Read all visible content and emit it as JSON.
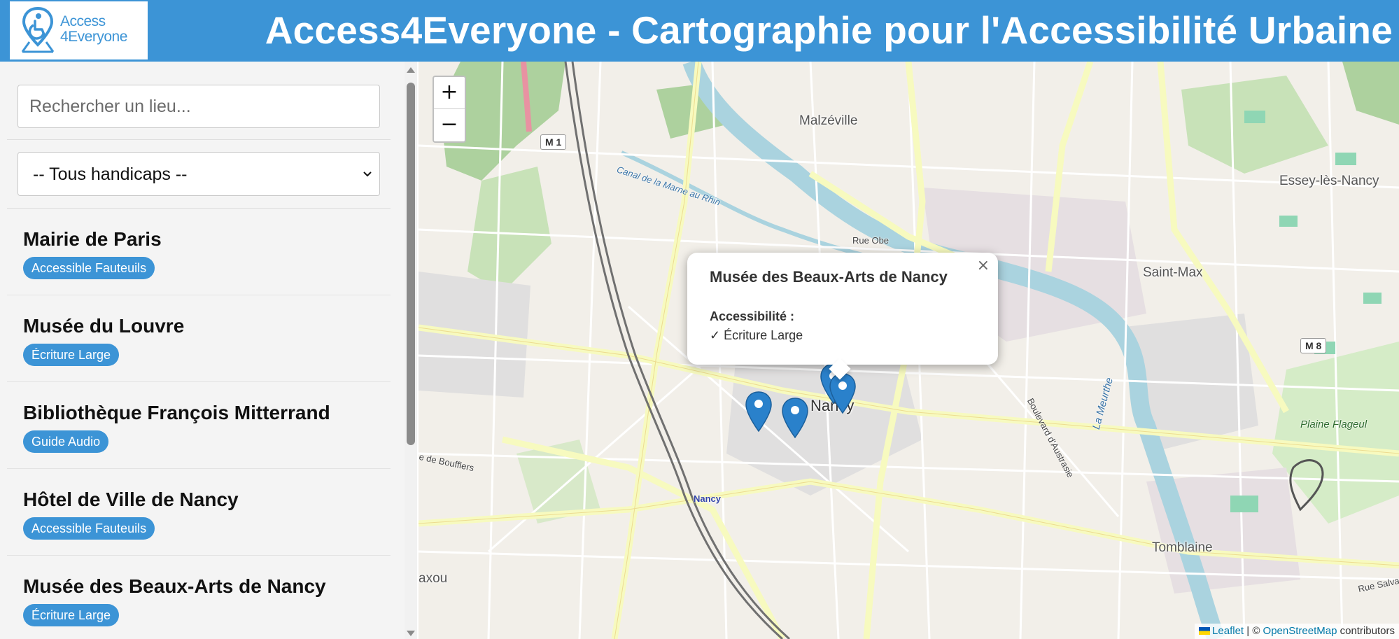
{
  "header": {
    "logo_line1": "Access",
    "logo_line2": "4Everyone",
    "title": "Access4Everyone - Cartographie pour l'Accessibilité Urbaine"
  },
  "sidebar": {
    "search": {
      "placeholder": "Rechercher un lieu...",
      "value": ""
    },
    "filter": {
      "selected": "-- Tous handicaps --"
    },
    "places": [
      {
        "name": "Mairie de Paris",
        "badge": "Accessible Fauteuils"
      },
      {
        "name": "Musée du Louvre",
        "badge": "Écriture Large"
      },
      {
        "name": "Bibliothèque François Mitterrand",
        "badge": "Guide Audio"
      },
      {
        "name": "Hôtel de Ville de Nancy",
        "badge": "Accessible Fauteuils"
      },
      {
        "name": "Musée des Beaux-Arts de Nancy",
        "badge": "Écriture Large"
      }
    ]
  },
  "map": {
    "zoom_in": "+",
    "zoom_out": "−",
    "labels": {
      "malzeville": "Malzéville",
      "essey": "Essey-lès-Nancy",
      "saint_max": "Saint-Max",
      "nancy": "Nancy",
      "nancy_station": "Nancy",
      "tomblaine": "Tomblaine",
      "laxou": "axou",
      "plaine_flageul": "Plaine Flageul",
      "la_meurthe": "La Meurthe",
      "rue_obe": "Rue Obe",
      "canal": "Canal de la Marne au Rhin",
      "boulevard": "Boulevard d'Austrasie",
      "bouffiers": "e de Boufflers",
      "rue_salva": "Rue Salva",
      "m1": "M 1",
      "m8": "M 8"
    },
    "popup": {
      "title": "Musée des Beaux-Arts de Nancy",
      "close": "×",
      "accessibility_label": "Accessibilité :",
      "feature": "✓ Écriture Large"
    },
    "attribution": {
      "leaflet": "Leaflet",
      "separator": " | © ",
      "osm": "OpenStreetMap",
      "suffix": " contributors"
    }
  },
  "colors": {
    "header": "#3c94d6",
    "badge": "#3c94d6",
    "marker": "#2a81cb"
  }
}
